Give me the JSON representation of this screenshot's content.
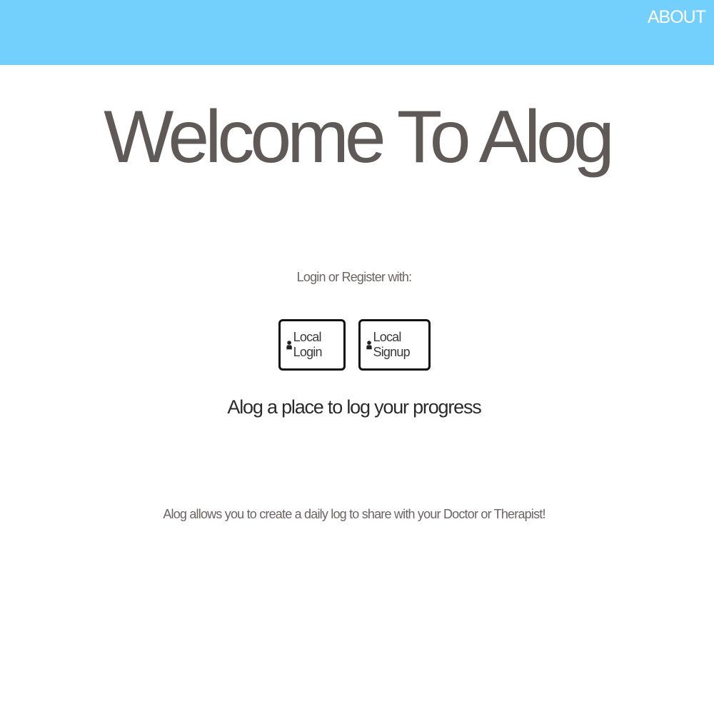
{
  "navbar": {
    "about_label": "ABOUT",
    "background_color": "#73cffb"
  },
  "hero": {
    "title": "Welcome To Alog"
  },
  "auth": {
    "prompt": "Login or Register with:",
    "login_label": "Local Login",
    "signup_label": "Local Signup",
    "icon": "user-icon"
  },
  "tagline": "Alog a place to log your progress",
  "description": "Alog allows you to create a daily log to share with your Doctor or Therapist!"
}
